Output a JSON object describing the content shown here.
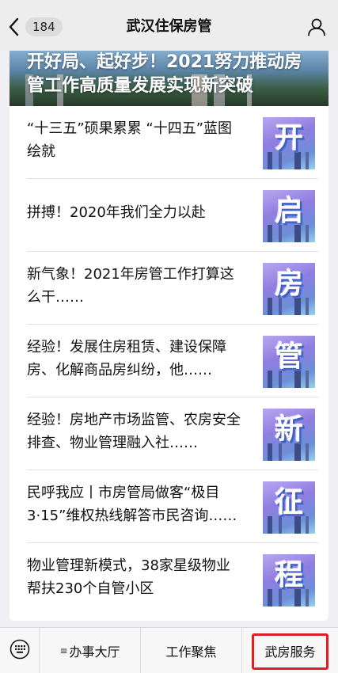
{
  "header": {
    "unread_count": "184",
    "title": "武汉住保房管"
  },
  "banner": {
    "title": "开好局、起好步！2021努力推动房管工作高质量发展实现新突破"
  },
  "articles": [
    {
      "title": "“十三五”硕果累累 “十四五”蓝图绘就",
      "thumb_char": "开"
    },
    {
      "title": "拼搏！2020年我们全力以赴",
      "thumb_char": "启"
    },
    {
      "title": "新气象！2021年房管工作打算这么干……",
      "thumb_char": "房"
    },
    {
      "title": "经验！发展住房租赁、建设保障房、化解商品房纠纷，他……",
      "thumb_char": "管"
    },
    {
      "title": "经验！房地产市场监管、农房安全排查、物业管理融入社……",
      "thumb_char": "新"
    },
    {
      "title": "民呼我应丨市房管局做客“极目3·15”维权热线解答市民咨询……",
      "thumb_char": "征"
    },
    {
      "title": "物业管理新模式，38家星级物业帮扶230个自管小区",
      "thumb_char": "程"
    }
  ],
  "bottom_menu": {
    "item1_prefix": "≡",
    "item1": "办事大厅",
    "item2": "工作聚焦",
    "item3": "武房服务"
  },
  "colors": {
    "highlight": "#e02020",
    "header_bg": "#ededed"
  },
  "icons": {
    "back": "chevron-left-icon",
    "profile": "user-icon",
    "keyboard": "keyboard-icon"
  }
}
